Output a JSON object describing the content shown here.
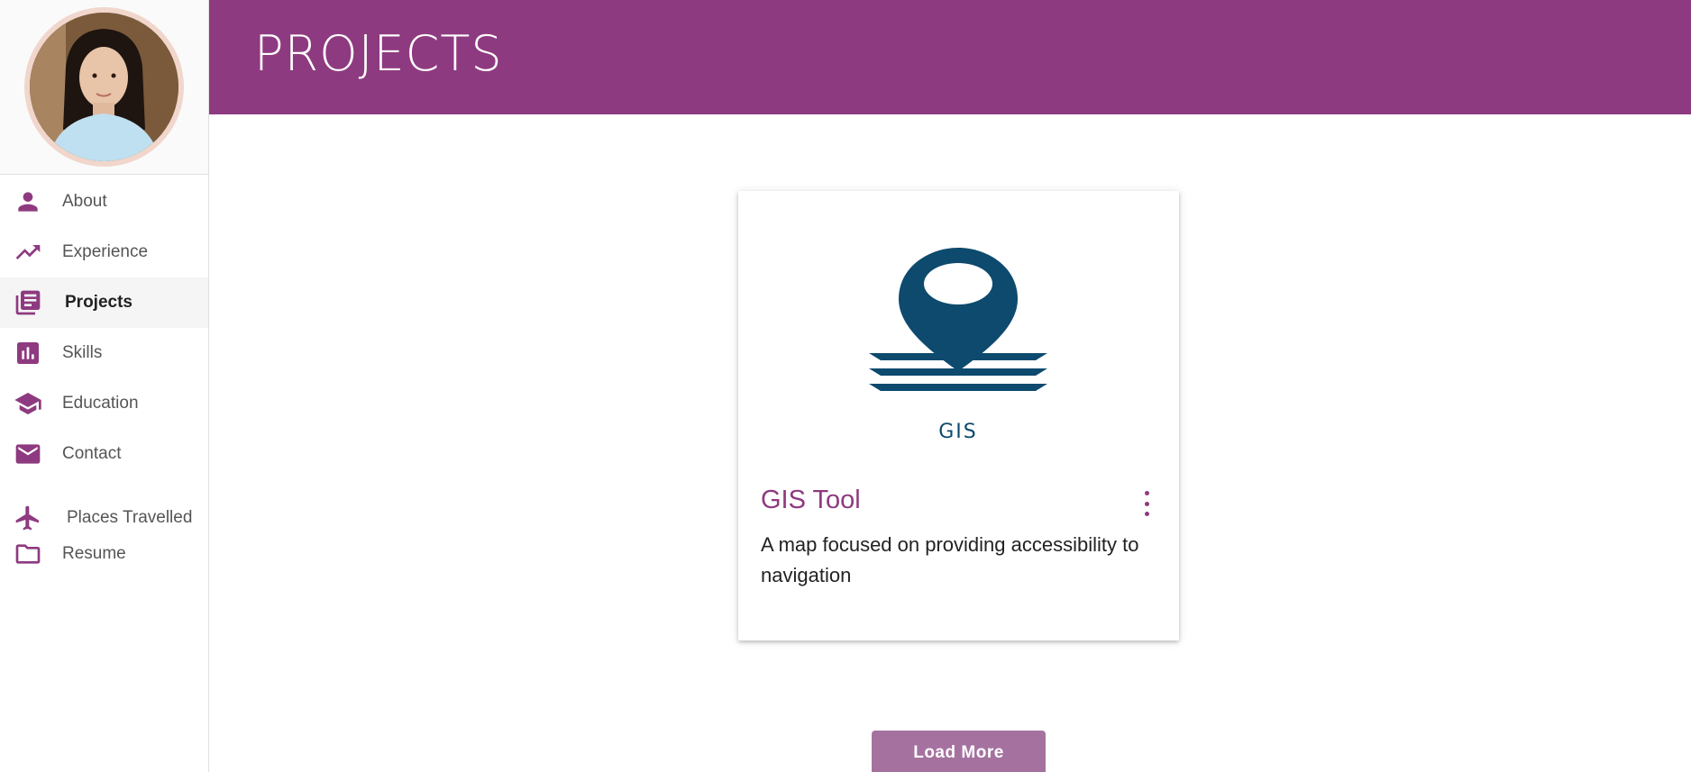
{
  "sidebar": {
    "items": [
      {
        "label": "About",
        "icon": "person-icon"
      },
      {
        "label": "Experience",
        "icon": "trending-up-icon"
      },
      {
        "label": "Projects",
        "icon": "library-books-icon",
        "active": true
      },
      {
        "label": "Skills",
        "icon": "bar-chart-icon"
      },
      {
        "label": "Education",
        "icon": "school-icon"
      },
      {
        "label": "Contact",
        "icon": "mail-icon"
      },
      {
        "label": "Places Travelled",
        "icon": "airplane-icon"
      },
      {
        "label": "Resume",
        "icon": "folder-icon"
      }
    ]
  },
  "header": {
    "title": "PROJECTS"
  },
  "projects": [
    {
      "title": "GIS Tool",
      "description": "A map focused on providing accessibility to navigation",
      "image_caption": "GIS"
    }
  ],
  "load_more_label": "Load More",
  "colors": {
    "accent": "#8e3a80",
    "button": "#a572a0",
    "map_pin": "#0d4a6e"
  }
}
